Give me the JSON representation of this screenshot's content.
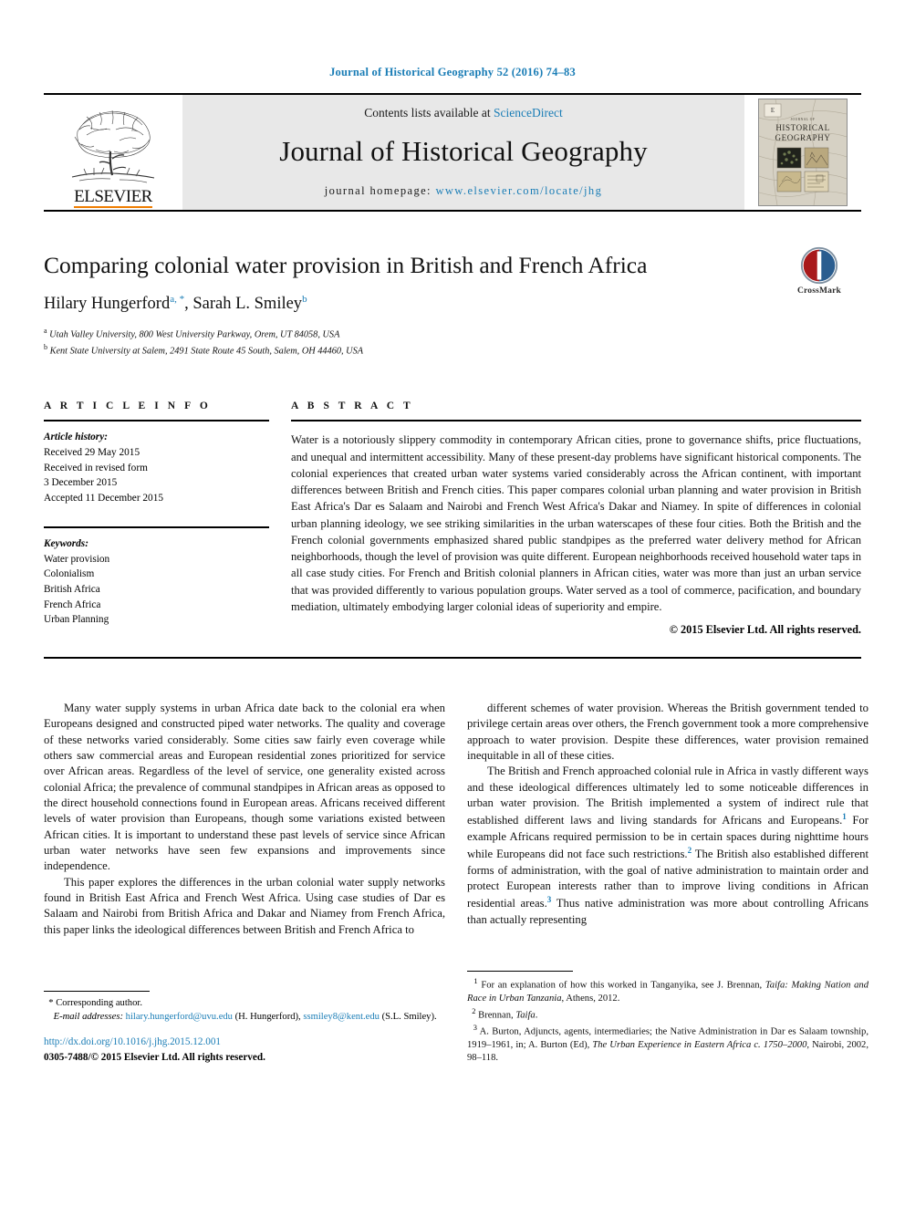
{
  "running_head": "Journal of Historical Geography 52 (2016) 74–83",
  "masthead": {
    "publisher_name": "ELSEVIER",
    "contents_prefix": "Contents lists available at ",
    "contents_link": "ScienceDirect",
    "journal_title": "Journal of Historical Geography",
    "homepage_prefix": "journal homepage: ",
    "homepage_url": "www.elsevier.com/locate/jhg",
    "cover_title_line1": "JOURNAL OF",
    "cover_title_line2": "HISTORICAL",
    "cover_title_line3": "GEOGRAPHY"
  },
  "article": {
    "title": "Comparing colonial water provision in British and French Africa",
    "authors_html": "Hilary Hungerford, Sarah L. Smiley",
    "author1": "Hilary Hungerford",
    "author1_marks": "a, *",
    "author2": "Sarah L. Smiley",
    "author2_marks": "b",
    "affiliation_a_mark": "a",
    "affiliation_a": "Utah Valley University, 800 West University Parkway, Orem, UT 84058, USA",
    "affiliation_b_mark": "b",
    "affiliation_b": "Kent State University at Salem, 2491 State Route 45 South, Salem, OH 44460, USA",
    "crossmark_label": "CrossMark"
  },
  "article_info": {
    "heading": "A R T I C L E   I N F O",
    "history_label": "Article history:",
    "history_lines": [
      "Received 29 May 2015",
      "Received in revised form",
      "3 December 2015",
      "Accepted 11 December 2015"
    ],
    "keywords_label": "Keywords:",
    "keywords": [
      "Water provision",
      "Colonialism",
      "British Africa",
      "French Africa",
      "Urban Planning"
    ]
  },
  "abstract": {
    "heading": "A B S T R A C T",
    "text": "Water is a notoriously slippery commodity in contemporary African cities, prone to governance shifts, price fluctuations, and unequal and intermittent accessibility. Many of these present-day problems have significant historical components. The colonial experiences that created urban water systems varied considerably across the African continent, with important differences between British and French cities. This paper compares colonial urban planning and water provision in British East Africa's Dar es Salaam and Nairobi and French West Africa's Dakar and Niamey. In spite of differences in colonial urban planning ideology, we see striking similarities in the urban waterscapes of these four cities. Both the British and the French colonial governments emphasized shared public standpipes as the preferred water delivery method for African neighborhoods, though the level of provision was quite different. European neighborhoods received household water taps in all case study cities. For French and British colonial planners in African cities, water was more than just an urban service that was provided differently to various population groups. Water served as a tool of commerce, pacification, and boundary mediation, ultimately embodying larger colonial ideas of superiority and empire.",
    "copyright": "© 2015 Elsevier Ltd. All rights reserved."
  },
  "body": {
    "left_paragraph_1": "Many water supply systems in urban Africa date back to the colonial era when Europeans designed and constructed piped water networks. The quality and coverage of these networks varied considerably. Some cities saw fairly even coverage while others saw commercial areas and European residential zones prioritized for service over African areas. Regardless of the level of service, one generality existed across colonial Africa; the prevalence of communal standpipes in African areas as opposed to the direct household connections found in European areas. Africans received different levels of water provision than Europeans, though some variations existed between African cities. It is important to understand these past levels of service since African urban water networks have seen few expansions and improvements since independence.",
    "left_paragraph_2": "This paper explores the differences in the urban colonial water supply networks found in British East Africa and French West Africa. Using case studies of Dar es Salaam and Nairobi from British Africa and Dakar and Niamey from French Africa, this paper links the ideological differences between British and French Africa to",
    "right_paragraph_1": "different schemes of water provision. Whereas the British government tended to privilege certain areas over others, the French government took a more comprehensive approach to water provision. Despite these differences, water provision remained inequitable in all of these cities.",
    "right_paragraph_2_a": "The British and French approached colonial rule in Africa in vastly different ways and these ideological differences ultimately led to some noticeable differences in urban water provision. The British implemented a system of indirect rule that established different laws and living standards for Africans and Europeans.",
    "right_paragraph_2_mark1": "1",
    "right_paragraph_2_b": " For example Africans required permission to be in certain spaces during nighttime hours while Europeans did not face such restrictions.",
    "right_paragraph_2_mark2": "2",
    "right_paragraph_2_c": " The British also established different forms of administration, with the goal of native administration to maintain order and protect European interests rather than to improve living conditions in African residential areas.",
    "right_paragraph_2_mark3": "3",
    "right_paragraph_2_d": " Thus native administration was more about controlling Africans than actually representing"
  },
  "footnotes": {
    "fn1_mark": "1",
    "fn1_a": " For an explanation of how this worked in Tanganyika, see J. Brennan, ",
    "fn1_italic": "Taifa: Making Nation and Race in Urban Tanzania",
    "fn1_b": ", Athens, 2012.",
    "fn2_mark": "2",
    "fn2_a": " Brennan, ",
    "fn2_italic": "Taifa",
    "fn2_b": ".",
    "fn3_mark": "3",
    "fn3_a": " A. Burton, Adjuncts, agents, intermediaries; the Native Administration in Dar es Salaam township, 1919–1961, in; A. Burton (Ed), ",
    "fn3_italic": "The Urban Experience in Eastern Africa c. 1750–2000",
    "fn3_b": ", Nairobi, 2002, 98–118."
  },
  "correspondence": {
    "star": "*",
    "corresponding_author": " Corresponding author.",
    "email_label": "E-mail addresses:",
    "email1": "hilary.hungerford@uvu.edu",
    "email1_owner": " (H. Hungerford), ",
    "email2": "ssmiley8@kent.edu",
    "email2_owner": " (S.L. Smiley).",
    "doi": "http://dx.doi.org/10.1016/j.jhg.2015.12.001",
    "issn_line": "0305-7488/© 2015 Elsevier Ltd. All rights reserved."
  },
  "colors": {
    "link_blue": "#1a7db6",
    "elsevier_orange": "#ef7d00",
    "masthead_gray": "#e8e8e8"
  }
}
